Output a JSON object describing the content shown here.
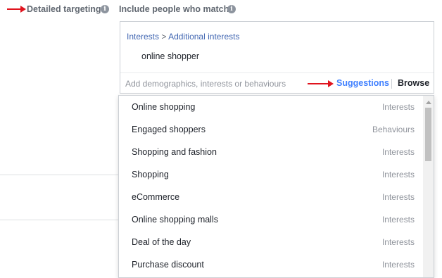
{
  "detailed_targeting": {
    "label": "Detailed targeting",
    "info_icon": "i"
  },
  "include": {
    "label": "Include people who match",
    "info_icon": "i"
  },
  "selected": {
    "breadcrumb_root": "Interests",
    "breadcrumb_sep": ">",
    "breadcrumb_leaf": "Additional interests",
    "item": "online shopper"
  },
  "search": {
    "placeholder": "Add demographics, interests or behaviours",
    "value": ""
  },
  "actions": {
    "suggestions_label": "Suggestions",
    "browse_label": "Browse"
  },
  "suggestions": [
    {
      "name": "Online shopping",
      "type": "Interests"
    },
    {
      "name": "Engaged shoppers",
      "type": "Behaviours"
    },
    {
      "name": "Shopping and fashion",
      "type": "Interests"
    },
    {
      "name": "Shopping",
      "type": "Interests"
    },
    {
      "name": "eCommerce",
      "type": "Interests"
    },
    {
      "name": "Online shopping malls",
      "type": "Interests"
    },
    {
      "name": "Deal of the day",
      "type": "Interests"
    },
    {
      "name": "Purchase discount",
      "type": "Interests"
    }
  ],
  "colors": {
    "annotation_arrow": "#e0141e",
    "link_blue": "#4267b2",
    "suggestions_blue": "#4080ff"
  }
}
